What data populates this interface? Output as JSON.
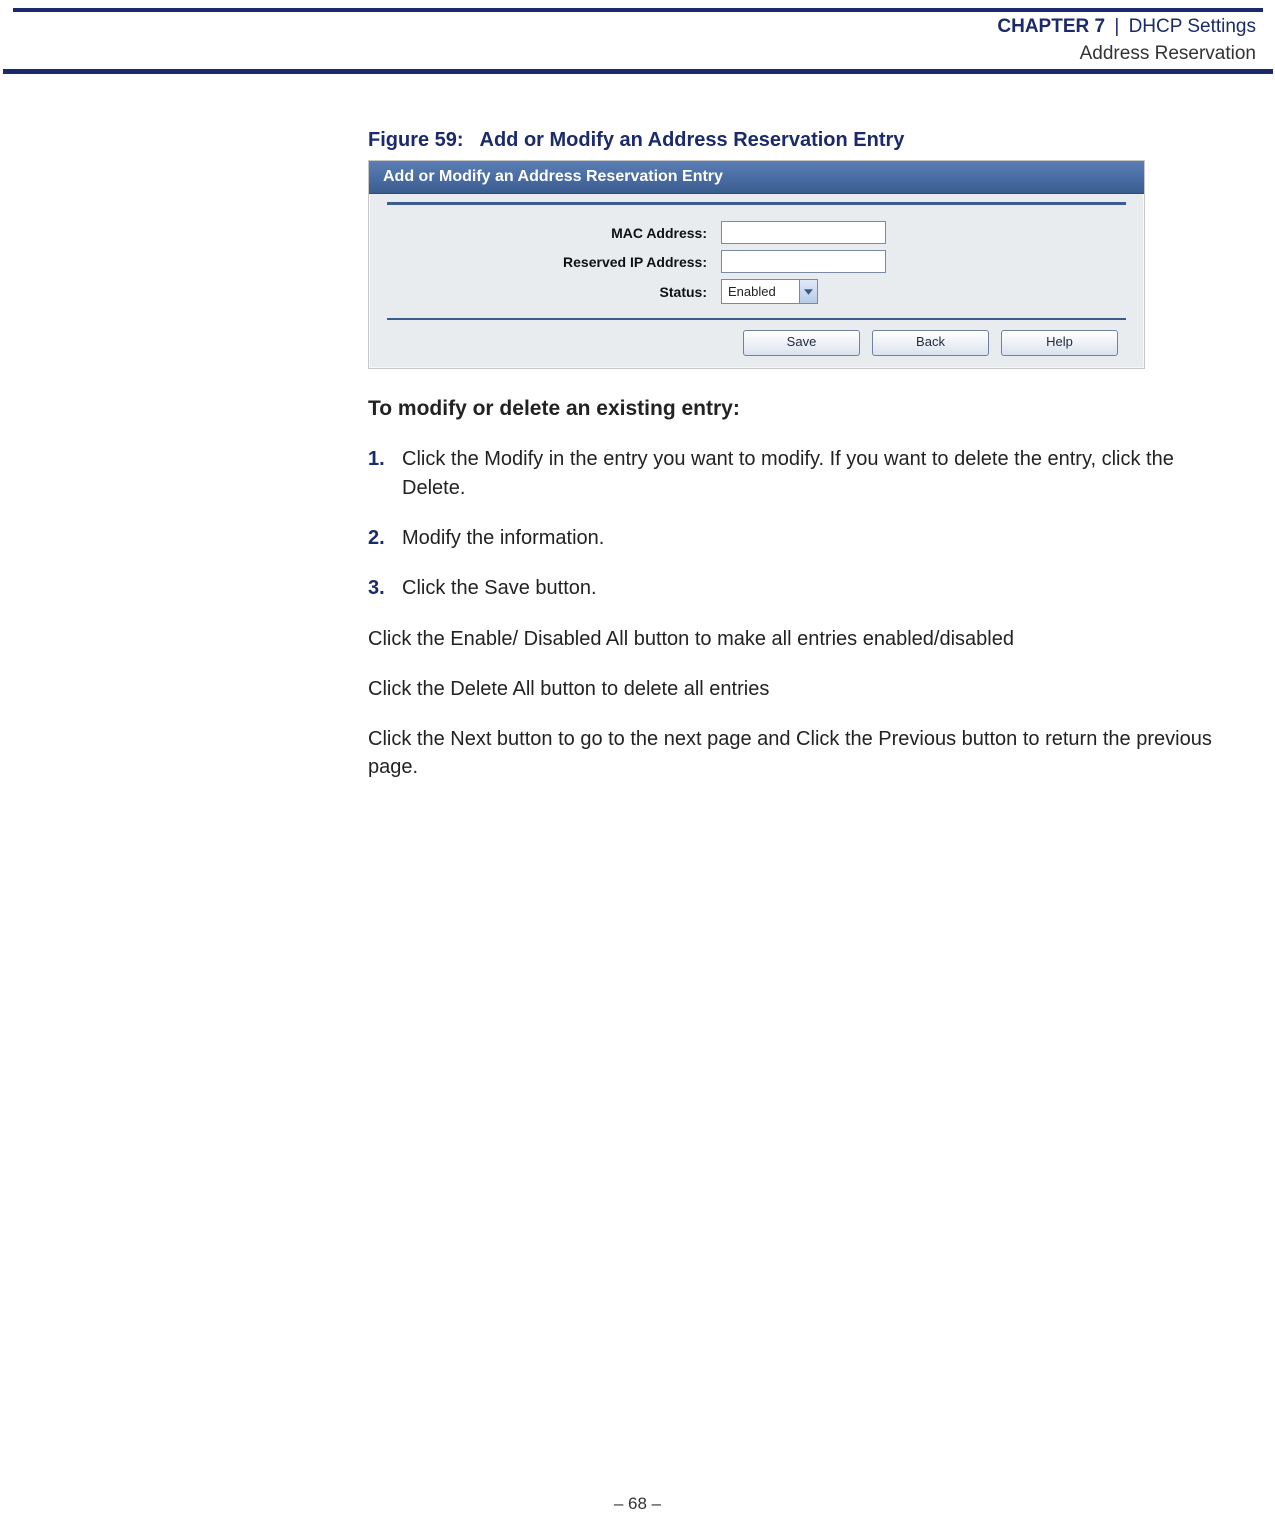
{
  "header": {
    "chapter_label": "CHAPTER 7",
    "separator": "|",
    "section_title": "DHCP Settings",
    "subsection_title": "Address Reservation"
  },
  "figure": {
    "caption_number": "Figure 59:",
    "caption_text": "Add or Modify an Address Reservation Entry"
  },
  "panel": {
    "title": "Add or Modify an Address Reservation Entry",
    "labels": {
      "mac": "MAC Address:",
      "ip": "Reserved IP Address:",
      "status": "Status:"
    },
    "values": {
      "mac": "",
      "ip": "",
      "status": "Enabled"
    },
    "buttons": {
      "save": "Save",
      "back": "Back",
      "help": "Help"
    }
  },
  "body": {
    "section_heading": "To modify or delete an existing entry:",
    "steps": [
      "Click the Modify in the entry you want to modify. If you want to delete the entry, click the Delete.",
      "Modify the information.",
      "Click the Save button."
    ],
    "step_numbers": [
      "1.",
      "2.",
      "3."
    ],
    "paragraphs": [
      "Click the Enable/ Disabled All button to make all entries enabled/disabled",
      "Click the Delete All button to delete all entries",
      "Click the Next button to go to the next page and Click the Previous button to return the previous page."
    ]
  },
  "footer": {
    "text": "–  68  –"
  }
}
